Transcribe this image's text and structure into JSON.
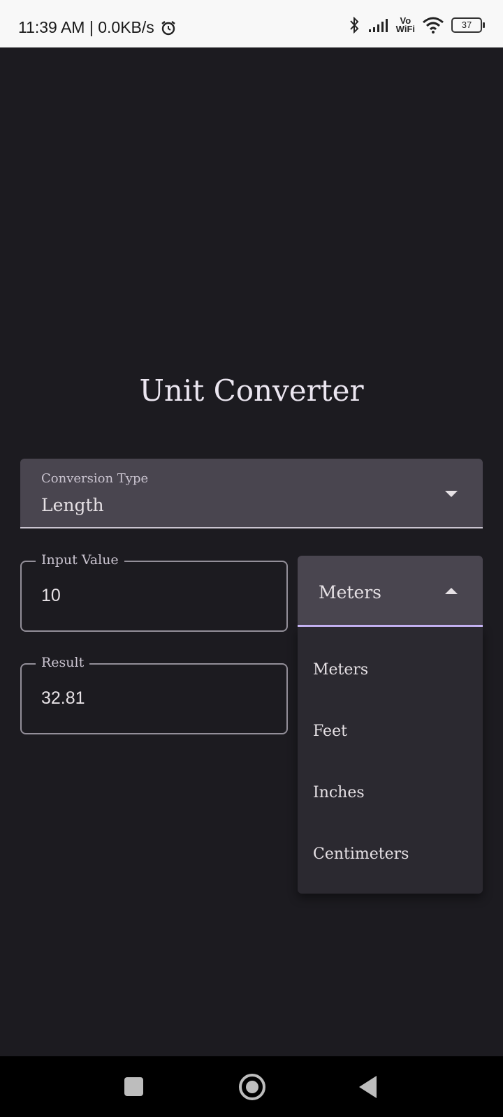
{
  "status_bar": {
    "time_speed": "11:39 AM | 0.0KB/s",
    "vowifi_line1": "Vo",
    "vowifi_line2": "WiFi",
    "battery": "37",
    "icons": [
      "alarm-icon",
      "bluetooth-icon",
      "signal-icon",
      "wifi-icon",
      "battery-icon"
    ]
  },
  "app": {
    "title": "Unit Converter",
    "conversion_type": {
      "label": "Conversion Type",
      "value": "Length"
    },
    "input": {
      "label": "Input Value",
      "value": "10"
    },
    "result": {
      "label": "Result",
      "value": "32.81"
    },
    "unit_select": {
      "value": "Meters",
      "options": [
        "Meters",
        "Feet",
        "Inches",
        "Centimeters"
      ]
    }
  },
  "colors": {
    "background": "#1c1b20",
    "surface_variant": "#49454f",
    "menu_surface": "#2b2930",
    "accent": "#cfbcff",
    "on_surface": "#e6e1e5"
  },
  "nav_bar": {
    "buttons": [
      "recent-apps",
      "home",
      "back"
    ]
  }
}
